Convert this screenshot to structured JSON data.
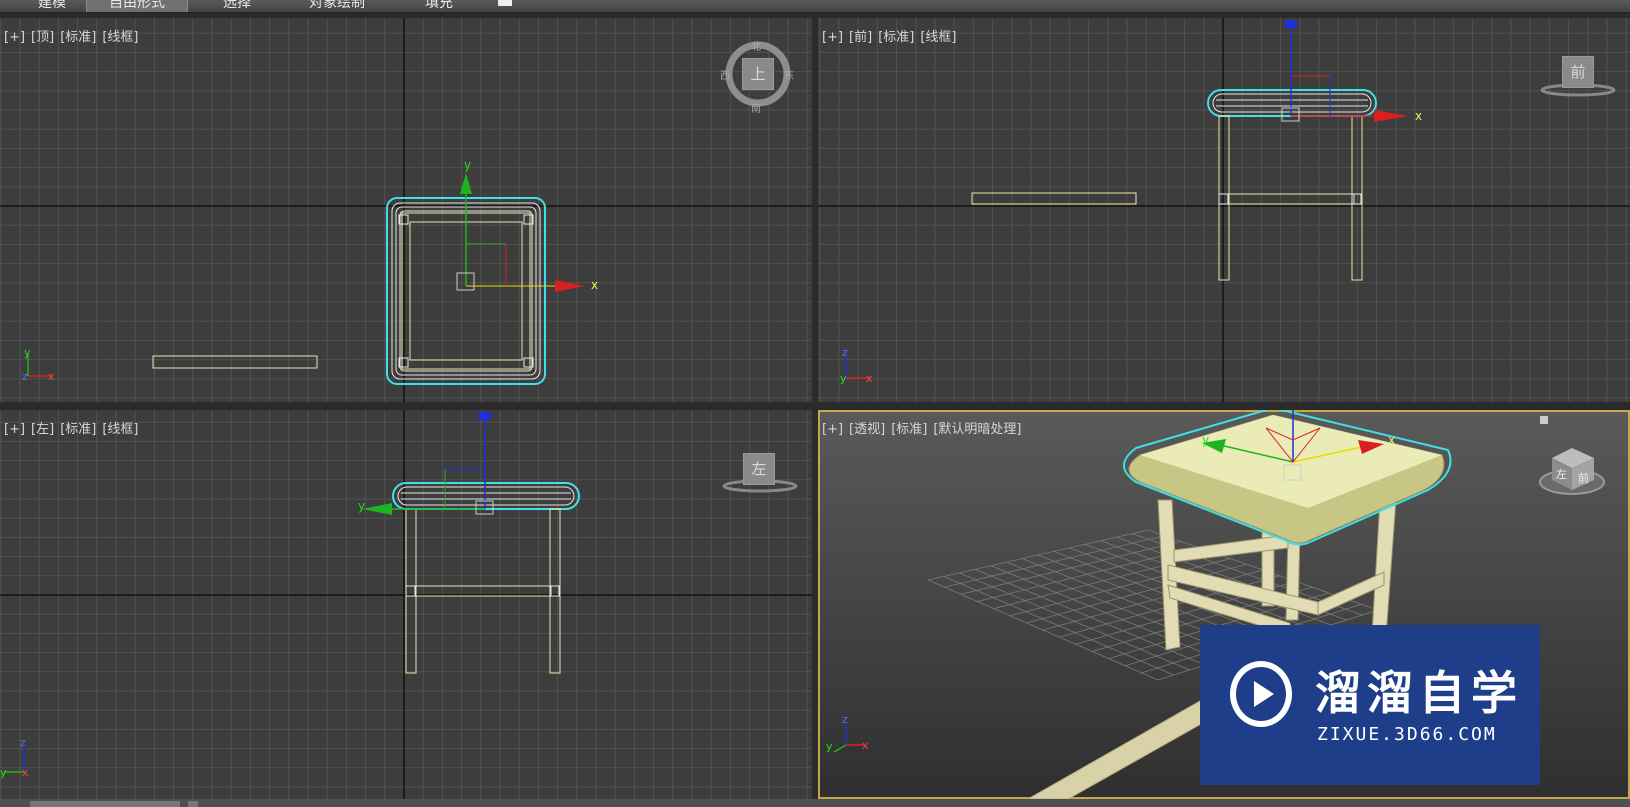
{
  "ribbon": {
    "tabs": [
      "建模",
      "自由形式",
      "选择",
      "对象绘制",
      "填充"
    ],
    "active_tab": "自由形式"
  },
  "viewports": {
    "top": {
      "plus": "[+]",
      "view": "[顶]",
      "mode": "[标准]",
      "shading": "[线框]"
    },
    "front": {
      "plus": "[+]",
      "view": "[前]",
      "mode": "[标准]",
      "shading": "[线框]"
    },
    "left": {
      "plus": "[+]",
      "view": "[左]",
      "mode": "[标准]",
      "shading": "[线框]"
    },
    "perspective": {
      "plus": "[+]",
      "view": "[透视]",
      "mode": "[标准]",
      "shading": "[默认明暗处理]"
    }
  },
  "viewcube": {
    "top": {
      "face": "上",
      "north": "北",
      "south": "南",
      "east": "东",
      "west": "西"
    },
    "front": {
      "face": "前"
    },
    "left": {
      "face": "左"
    },
    "perspective": {
      "face_front": "前",
      "face_left": "左"
    }
  },
  "axes": {
    "x": "x",
    "y": "y",
    "z": "z"
  },
  "watermark": {
    "title": "溜溜自学",
    "url": "ZIXUE.3D66.COM"
  },
  "colors": {
    "viewport_bg": "#3d3d3d",
    "grid_line": "#525252",
    "main_axis": "#111111",
    "selection": "#3fe0e6",
    "wire": "#efe5a9",
    "axis_x": "#d91f1f",
    "axis_y": "#1fb31f",
    "axis_z": "#1f2fd9",
    "active_border": "#c8a64a",
    "stool_seat": "#e6e6b0",
    "watermark_bg": "#1e3e8a"
  }
}
